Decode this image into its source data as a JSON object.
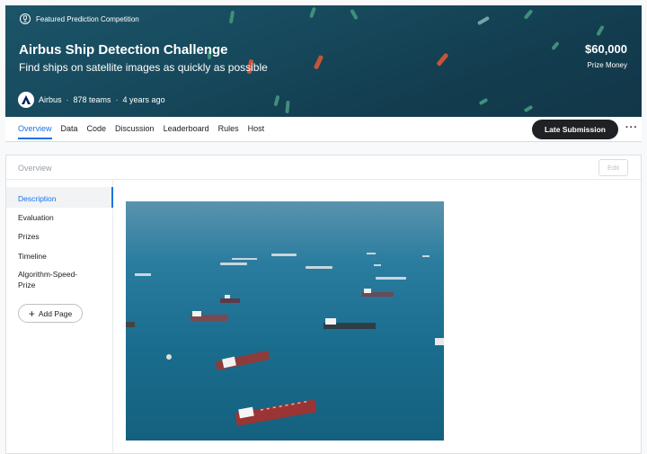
{
  "banner": {
    "featured_label": "Featured Prediction Competition",
    "title": "Airbus Ship Detection Challenge",
    "subtitle": "Find ships on satellite images as quickly as possible",
    "prize_amount": "$60,000",
    "prize_label": "Prize Money",
    "host_name": "Airbus",
    "teams": "878 teams",
    "age": "4 years ago",
    "separator": "·"
  },
  "tabs": [
    {
      "label": "Overview",
      "active": true
    },
    {
      "label": "Data"
    },
    {
      "label": "Code"
    },
    {
      "label": "Discussion"
    },
    {
      "label": "Leaderboard"
    },
    {
      "label": "Rules"
    },
    {
      "label": "Host"
    }
  ],
  "actions": {
    "late_submission": "Late Submission",
    "more": "···"
  },
  "card": {
    "header": "Overview",
    "edit": "Edit"
  },
  "sidenav": {
    "items": [
      {
        "label": "Description",
        "active": true
      },
      {
        "label": "Evaluation"
      },
      {
        "label": "Prizes"
      },
      {
        "label": "Timeline"
      },
      {
        "label": "Algorithm-Speed-Prize"
      }
    ],
    "add_page": "Add Page"
  },
  "colors": {
    "accent": "#1a73e8",
    "button_dark": "#202124",
    "sea": "#1c6f94"
  }
}
